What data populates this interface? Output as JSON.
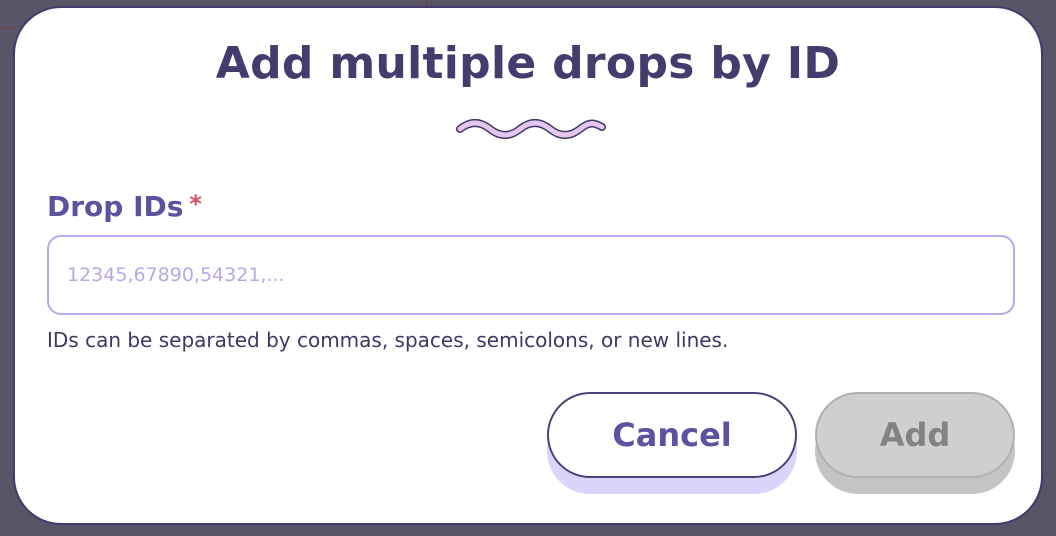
{
  "dialog": {
    "title": "Add multiple drops by ID",
    "field": {
      "label": "Drop IDs",
      "required_marker": "*",
      "value": "",
      "placeholder": "12345,67890,54321,..."
    },
    "helper_text": "IDs can be separated by commas, spaces, semicolons, or new lines.",
    "buttons": {
      "cancel_label": "Cancel",
      "add_label": "Add",
      "add_disabled": true
    }
  },
  "colors": {
    "title": "#433d6e",
    "label": "#5b52a0",
    "required": "#d04c67",
    "input_border": "#b9a9ec",
    "cancel_shadow": "#dcd5fb",
    "disabled_button": "#cfcfcf"
  },
  "icons": {
    "decoration": "squiggle-divider"
  }
}
